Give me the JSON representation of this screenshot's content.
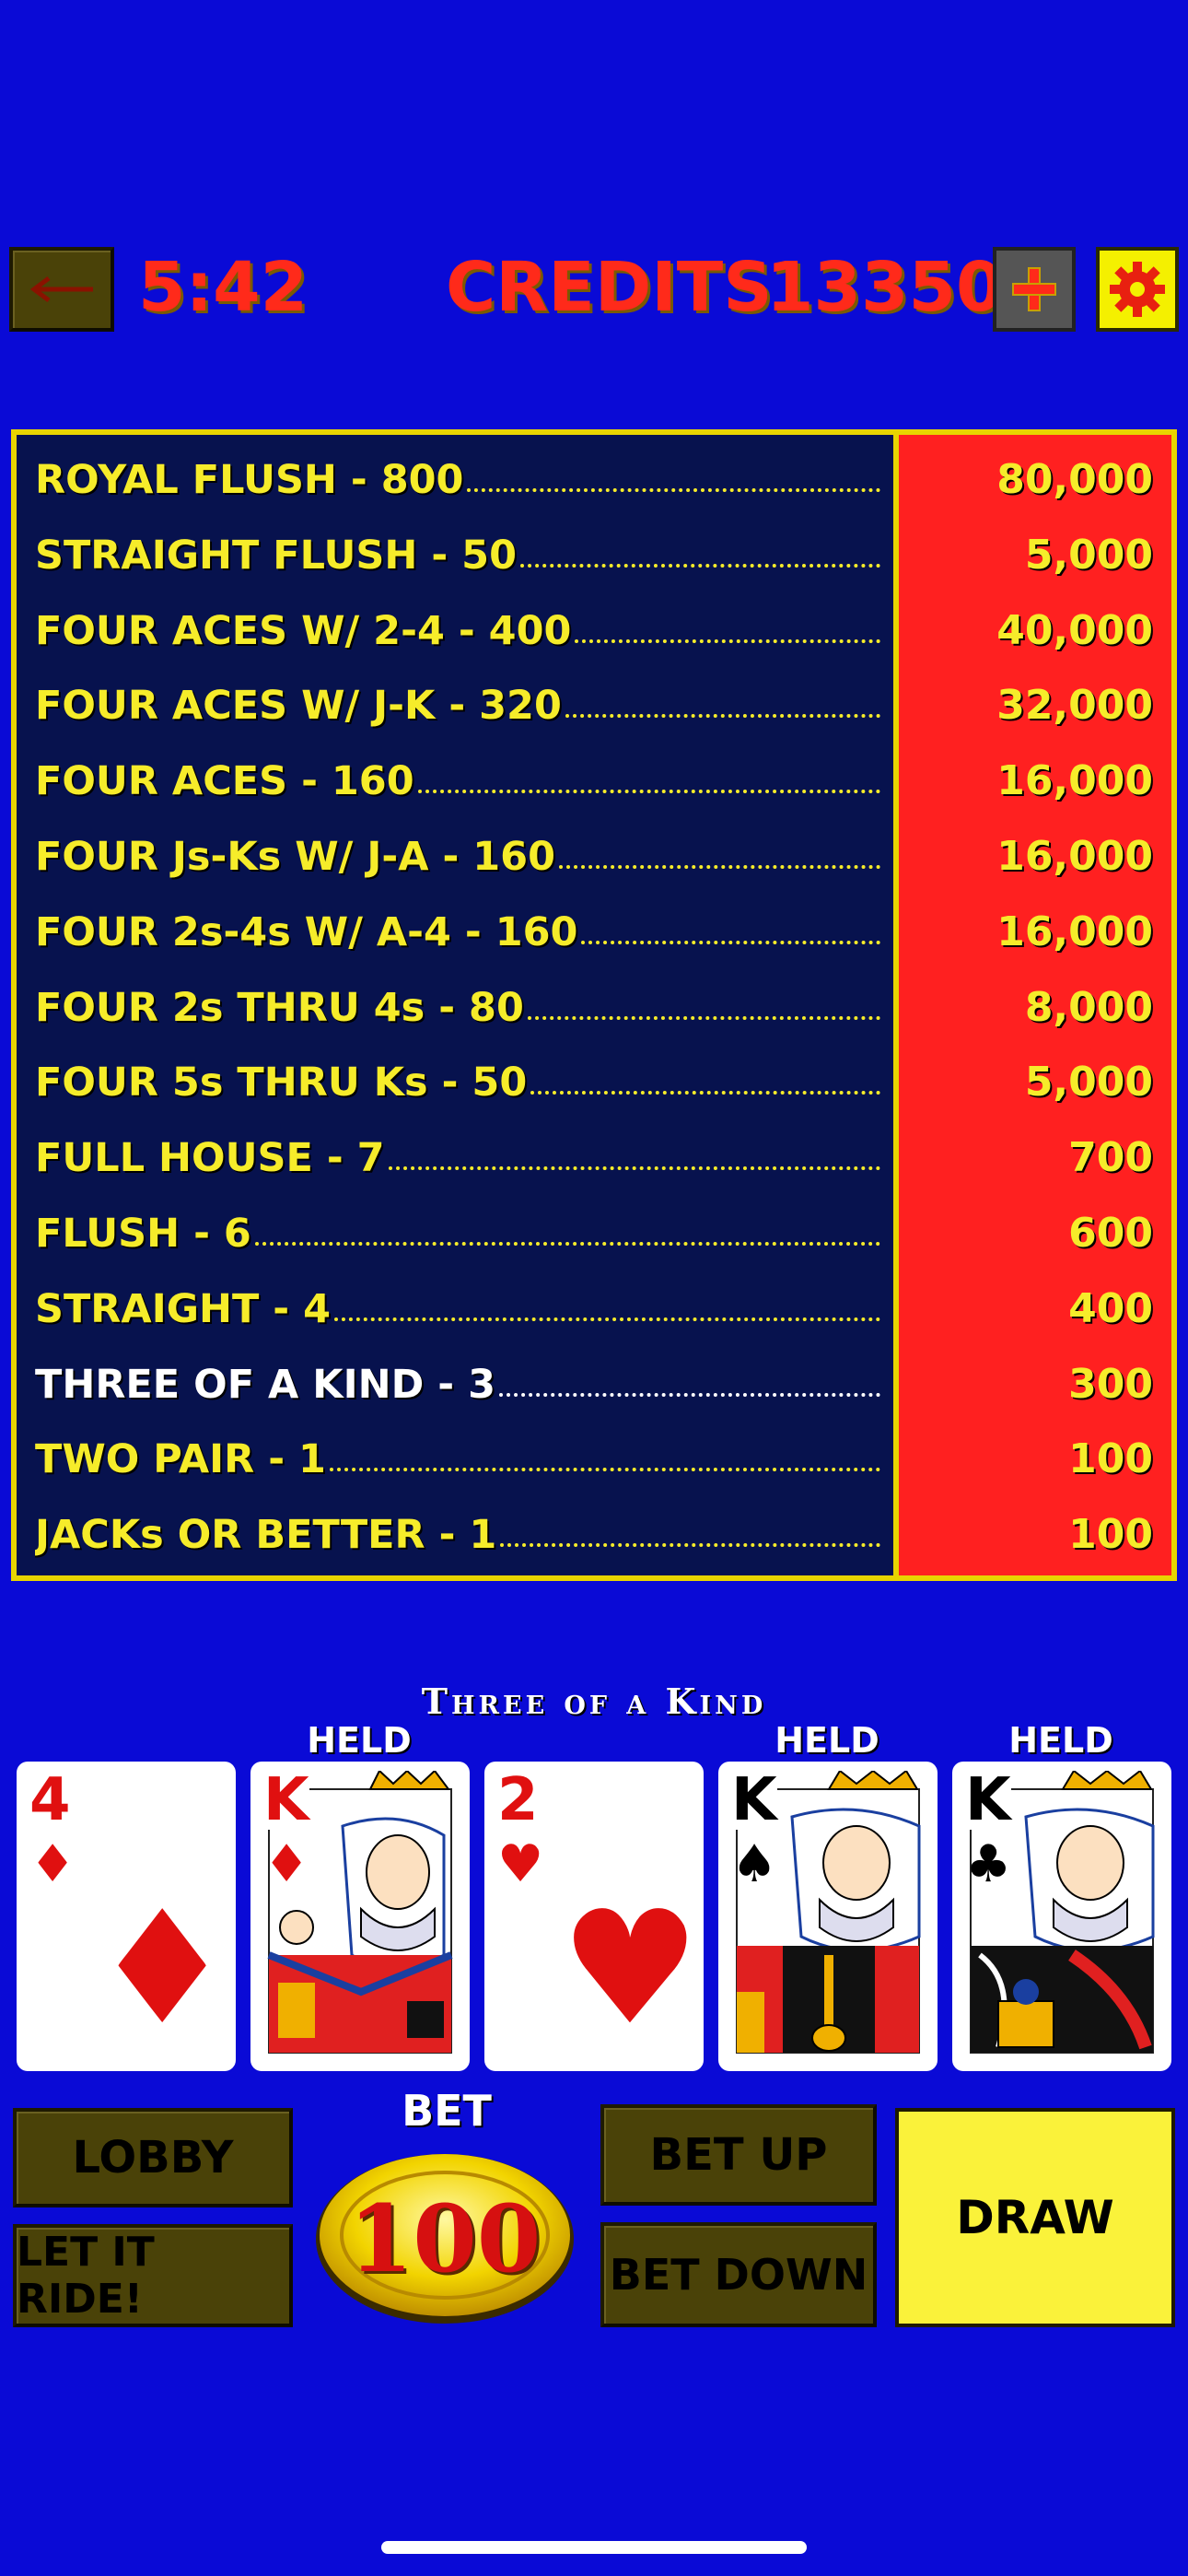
{
  "header": {
    "timer": "5:42",
    "credits_label": "CREDITS",
    "credits_value": "13350",
    "back_icon": "back-arrow-icon",
    "add_icon": "plus-icon",
    "settings_icon": "gear-icon"
  },
  "paytable": [
    {
      "name": "ROYAL FLUSH - 800",
      "value": "80,000"
    },
    {
      "name": "STRAIGHT FLUSH - 50",
      "value": "5,000"
    },
    {
      "name": "FOUR ACES W/ 2-4 - 400",
      "value": "40,000"
    },
    {
      "name": "FOUR ACES W/ J-K - 320",
      "value": "32,000"
    },
    {
      "name": "FOUR ACES - 160",
      "value": "16,000"
    },
    {
      "name": "FOUR Js-Ks W/ J-A - 160",
      "value": "16,000"
    },
    {
      "name": "FOUR 2s-4s W/ A-4 - 160",
      "value": "16,000"
    },
    {
      "name": "FOUR 2s THRU 4s - 80",
      "value": "8,000"
    },
    {
      "name": "FOUR 5s THRU Ks - 50",
      "value": "5,000"
    },
    {
      "name": "FULL HOUSE - 7",
      "value": "700"
    },
    {
      "name": "FLUSH - 6",
      "value": "600"
    },
    {
      "name": "STRAIGHT - 4",
      "value": "400"
    },
    {
      "name": "THREE OF A KIND - 3",
      "value": "300"
    },
    {
      "name": "TWO PAIR - 1",
      "value": "100"
    },
    {
      "name": "JACKs OR BETTER - 1",
      "value": "100"
    }
  ],
  "highlighted_row": 12,
  "hand_result": "Three of a Kind",
  "held_label": "HELD",
  "cards": [
    {
      "rank": "4",
      "suit": "♦",
      "color": "red",
      "held": false
    },
    {
      "rank": "K",
      "suit": "♦",
      "color": "red",
      "held": true
    },
    {
      "rank": "2",
      "suit": "♥",
      "color": "red",
      "held": false
    },
    {
      "rank": "K",
      "suit": "♠",
      "color": "black",
      "held": true
    },
    {
      "rank": "K",
      "suit": "♣",
      "color": "black",
      "held": true
    }
  ],
  "controls": {
    "lobby": "LOBBY",
    "let_it_ride": "LET IT RIDE!",
    "bet_label": "BET",
    "bet_value": "100",
    "bet_up": "BET UP",
    "bet_down": "BET DOWN",
    "draw": "DRAW"
  },
  "colors": {
    "background": "#0a0ad6",
    "paytable_bg": "#07124e",
    "paytable_highlight": "#ff2020",
    "gold": "#f6ec2a",
    "red_text": "#ff2a1a"
  }
}
